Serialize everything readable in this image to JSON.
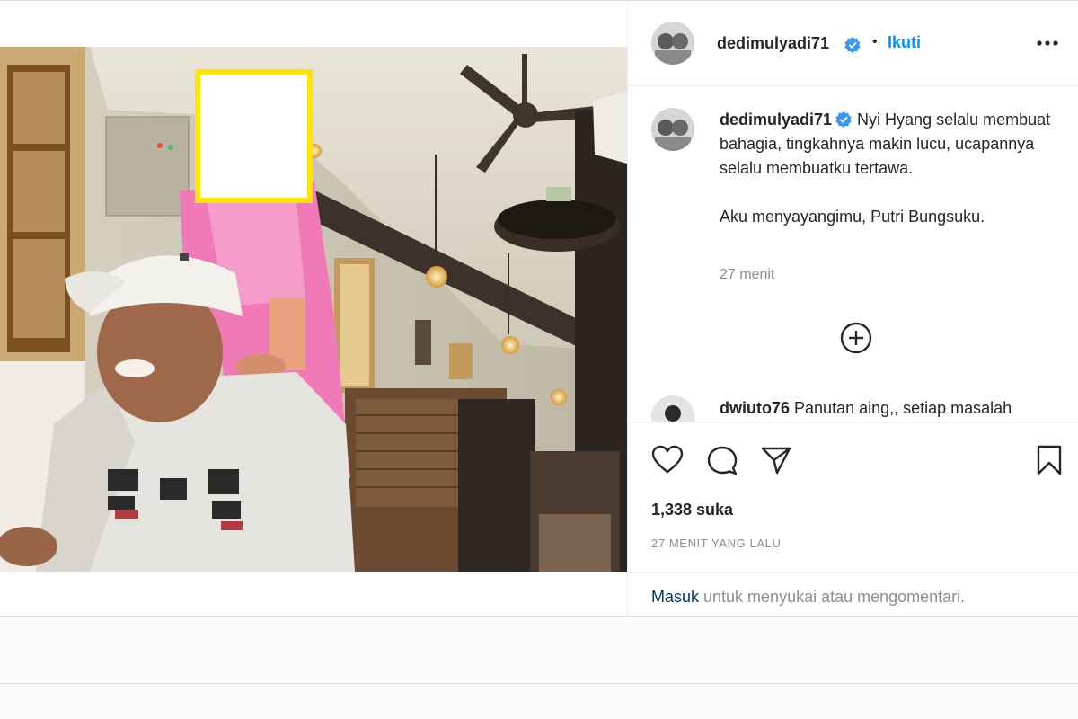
{
  "post": {
    "author": {
      "username": "dedimulyadi71",
      "verified": true,
      "follow_label": "Ikuti",
      "separator": "•"
    },
    "caption": {
      "username": "dedimulyadi71",
      "line1": "Nyi Hyang selalu membuat bahagia, tingkahnya makin lucu, ucapannya selalu membuatku tertawa.",
      "line2": "Aku menyayangimu, Putri Bungsuku.",
      "time": "27 menit"
    },
    "comments": [
      {
        "username": "dwiuto76",
        "text": "Panutan aing,, setiap masalah"
      }
    ],
    "likes": "1,338 suka",
    "posted_ago": "27 MENIT YANG LALU",
    "login_prompt": {
      "link": "Masuk",
      "text": " untuk menyukai atau mengomentari."
    },
    "icons": {
      "like": "heart-icon",
      "comment": "comment-icon",
      "share": "paper-plane-icon",
      "save": "bookmark-icon",
      "more": "more-options-icon",
      "add": "add-circle-icon",
      "verified": "verified-badge-icon"
    },
    "colors": {
      "accent": "#0095f6",
      "text": "#262626",
      "muted": "#8e8e8e",
      "verified": "#3897f0",
      "censor_box": "#ffe600"
    }
  }
}
